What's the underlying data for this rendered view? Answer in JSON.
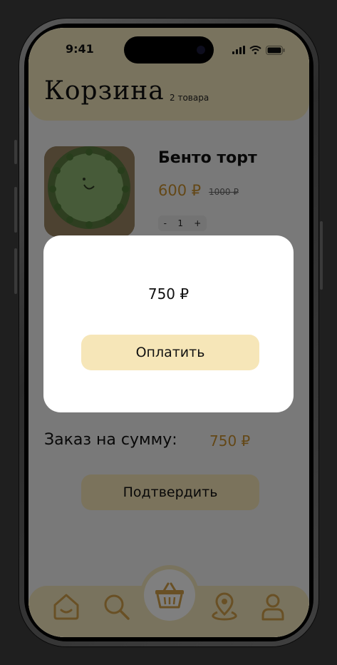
{
  "status_bar": {
    "time": "9:41"
  },
  "header": {
    "title": "Корзина",
    "items_count": "2 товара"
  },
  "product": {
    "name": "Бенто торт",
    "price": "600 ₽",
    "old_price": "1000 ₽",
    "quantity": "1",
    "decrement_label": "-",
    "increment_label": "+"
  },
  "summary": {
    "label": "Заказ на сумму:",
    "value": "750 ₽"
  },
  "confirm_button": "Подтвердить",
  "modal": {
    "amount": "750 ₽",
    "pay_button": "Оплатить"
  },
  "nav": {
    "items": [
      {
        "icon": "home-icon"
      },
      {
        "icon": "search-icon"
      },
      {
        "icon": "basket-icon",
        "active": true
      },
      {
        "icon": "location-icon"
      },
      {
        "icon": "profile-icon"
      }
    ]
  },
  "colors": {
    "accent": "#f3e6bc",
    "price": "#c8902f",
    "icon": "#d2a14a",
    "button": "#f6e6b8"
  }
}
